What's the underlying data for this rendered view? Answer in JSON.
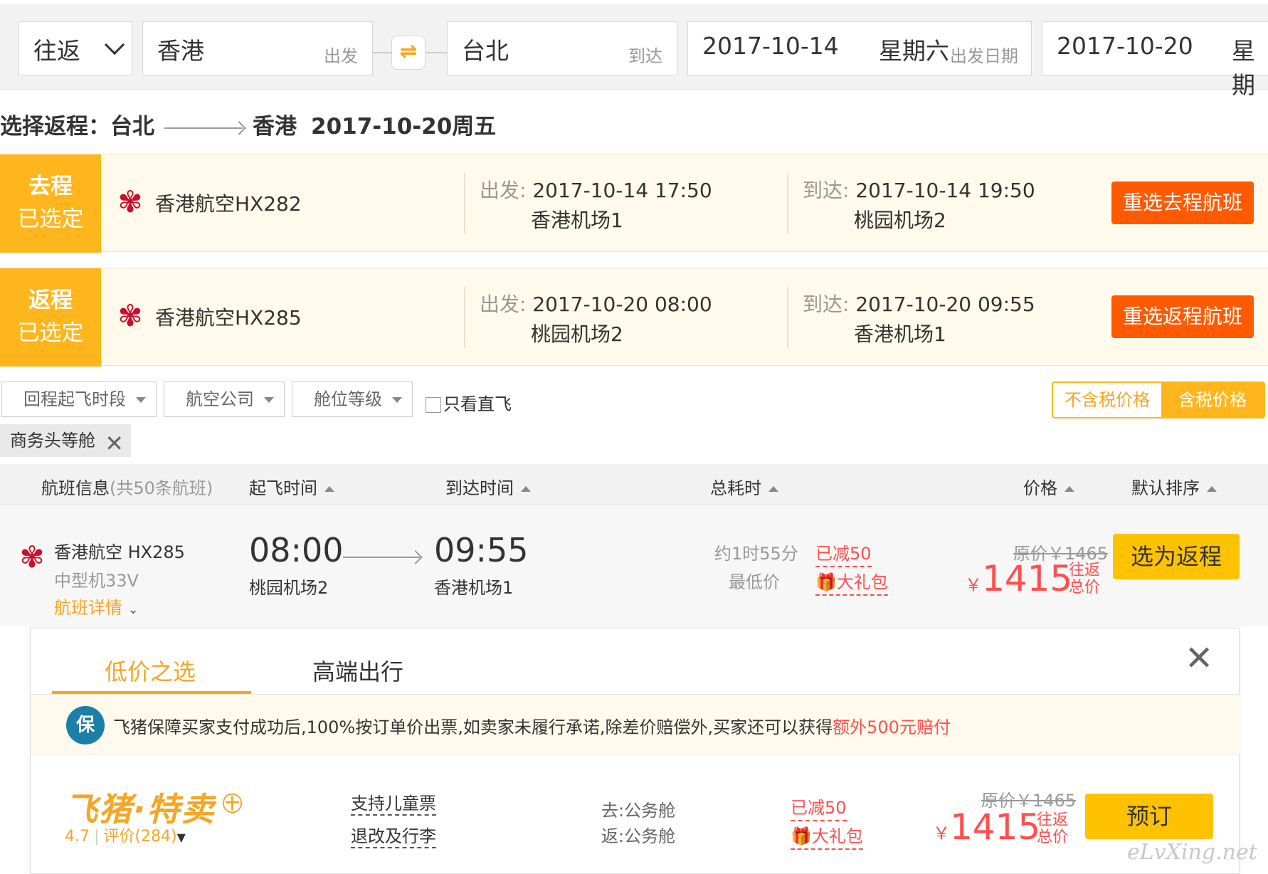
{
  "search": {
    "trip_type": "往返",
    "from_city": "香港",
    "from_hint": "出发",
    "to_city": "台北",
    "to_hint": "到达",
    "depart_date": "2017-10-14",
    "depart_weekday": "星期六",
    "depart_hint": "出发日期",
    "return_date": "2017-10-20",
    "return_weekday_partial": "星期",
    "swap_glyph": "⇌"
  },
  "heading": {
    "label": "选择返程：",
    "from": "台北",
    "to": "香港",
    "date": "2017-10-20周五"
  },
  "selected": [
    {
      "tag_line1": "去程",
      "tag_line2": "已选定",
      "flight": "香港航空HX282",
      "depart_label": "出发:",
      "depart_time": "2017-10-14 17:50",
      "depart_airport": "香港机场1",
      "arrive_label": "到达:",
      "arrive_time": "2017-10-14 19:50",
      "arrive_airport": "桃园机场2",
      "button": "重选去程航班"
    },
    {
      "tag_line1": "返程",
      "tag_line2": "已选定",
      "flight": "香港航空HX285",
      "depart_label": "出发:",
      "depart_time": "2017-10-20 08:00",
      "depart_airport": "桃园机场2",
      "arrive_label": "到达:",
      "arrive_time": "2017-10-20 09:55",
      "arrive_airport": "香港机场1",
      "button": "重选返程航班"
    }
  ],
  "filters": {
    "time": "回程起飞时段",
    "airline": "航空公司",
    "cabin": "舱位等级",
    "nonstop": "只看直飞",
    "price_excl": "不含税价格",
    "price_incl": "含税价格",
    "chip": "商务头等舱",
    "chip_close": "✕"
  },
  "list_header": {
    "info": "航班信息",
    "count": "(共50条航班)",
    "depart": "起飞时间",
    "arrive": "到达时间",
    "duration": "总耗时",
    "price": "价格",
    "sort": "默认排序"
  },
  "flight": {
    "airline": "香港航空 HX285",
    "aircraft": "中型机33V",
    "details": "航班详情",
    "depart_time": "08:00",
    "depart_airport": "桃园机场2",
    "arrive_time": "09:55",
    "arrive_airport": "香港机场1",
    "duration": "约1时55分",
    "lowest": "最低价",
    "discount": "已减50",
    "gift": "大礼包",
    "orig_price": "原价￥1465",
    "currency": "￥",
    "price": "1415",
    "price_note1": "往返",
    "price_note2": "总价",
    "button": "选为返程"
  },
  "detail": {
    "tab_low": "低价之选",
    "tab_high": "高端出行",
    "close": "✕",
    "shield": "保",
    "guarantee_text": "飞猪保障买家支付成功后,100%按订单价出票,如卖家未履行承诺,除差价赔偿外,买家还可以获得",
    "guarantee_highlight": "额外500元赔付",
    "seller": "飞猪·特卖",
    "seller_badge": "㊉",
    "rating": "4.7",
    "reviews": "评价(284)",
    "child_ticket": "支持儿童票",
    "change_baggage": "退改及行李",
    "outbound_cabin": "去:公务舱",
    "return_cabin": "返:公务舱",
    "discount": "已减50",
    "gift": "大礼包",
    "orig_price": "原价￥1465",
    "currency": "￥",
    "price": "1415",
    "price_note1": "往返",
    "price_note2": "总价",
    "book": "预订"
  },
  "watermark": "eLvXing.net",
  "colors": {
    "accent": "#ffb51c",
    "reselect": "#ff5a00",
    "price": "#ff4f4f",
    "cta": "#ffc200",
    "airline_red": "#c8102e"
  }
}
